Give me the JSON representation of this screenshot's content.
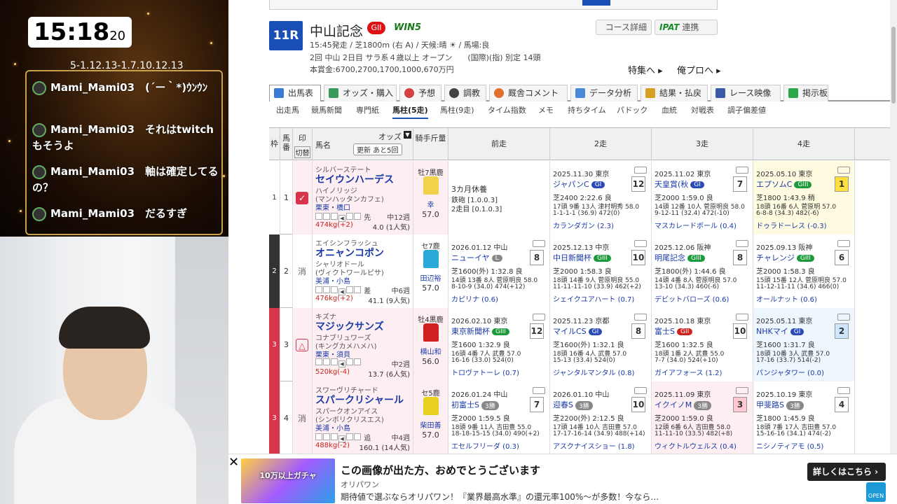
{
  "overlay": {
    "clock_main": "15:18",
    "clock_sec": "20",
    "ticker": "5-1.12.13-1.7.10.12.13",
    "chat": [
      {
        "user": "Mami_Mami03",
        "text": "(´ー｀*)ｳﾝｳﾝ"
      },
      {
        "user": "Mami_Mami03",
        "text": "それはtwitchもそうよ"
      },
      {
        "user": "Mami_Mami03",
        "text": "軸は確定してるの？"
      },
      {
        "user": "Mami_Mami03",
        "text": "だるすぎ"
      }
    ]
  },
  "race": {
    "number": "11R",
    "name": "中山記念",
    "grade": "GII",
    "win5": "WIN5",
    "line1": "15:45発走 / 芝1800m (右 A) / 天候:晴 ☀ / 馬場:良",
    "line2": "2回 中山 2日目 サラ系４歳以上 オープン　　(国際)(指) 別定 14頭",
    "line3": "本賞金:6700,2700,1700,1000,670万円",
    "course_link": "コース詳細",
    "ipat_label": "IPAT",
    "ipat_suffix": "連携",
    "feature_link": "特集へ ▸",
    "pro_link": "俺プロへ ▸"
  },
  "tabs": [
    {
      "label": "出馬表",
      "color": "#3a7bd5"
    },
    {
      "label": "オッズ・購入",
      "color": "#3a9a5a"
    },
    {
      "label": "予想",
      "color": "#d64040"
    },
    {
      "label": "調教",
      "color": "#444444"
    },
    {
      "label": "厩舎コメント",
      "color": "#e07030"
    },
    {
      "label": "データ分析",
      "color": "#4a8ad8"
    },
    {
      "label": "結果・払戻",
      "color": "#d8a020"
    },
    {
      "label": "レース映像",
      "color": "#3a5aa8"
    },
    {
      "label": "掲示板",
      "color": "#2aa84a"
    }
  ],
  "subtabs": [
    "出走馬",
    "競馬新聞",
    "専門紙",
    "馬柱(5走)",
    "馬柱(9走)",
    "タイム指数",
    "メモ",
    "持ちタイム",
    "パドック",
    "血統",
    "対戦表",
    "調子偏差値"
  ],
  "table": {
    "headers": {
      "waku": "枠",
      "uma": "馬番",
      "mark": "印",
      "mark_sub": "切替",
      "horse": "馬名",
      "odds": "オッズ",
      "update": "更新 あと5回",
      "jockey": "騎手斤量",
      "prev": "前走",
      "r2": "2走",
      "r3": "3走",
      "r4": "4走"
    },
    "rows": [
      {
        "waku": "1",
        "uma": "1",
        "mark": "✓",
        "waku_color": "#ffffff",
        "sire": "シルバーステート",
        "name": "セイウンハーデス",
        "dam": "ハイノリッジ",
        "bms": "(マンハッタンカフェ)",
        "stable": "栗東・橋口",
        "weeks": "中12週",
        "weight": "474kg(+2)",
        "odds": "4.0 (1人気)",
        "pos": "先",
        "sexage": "牡7黒鹿",
        "jockey": "幸",
        "kg": "57.0",
        "silk": "#f2d24a",
        "past": [
          {
            "date": "",
            "race": "3カ月休養",
            "l2": "鉄砲 [1.0.0.3]",
            "l3": "2走目 [0.1.0.3]",
            "l4": "",
            "l5": "",
            "place": "",
            "grade": "",
            "gcolor": ""
          },
          {
            "date": "2025.11.30 東京",
            "race": "ジャパンC",
            "grade": "GI",
            "gcolor": "#2a4ab8",
            "place": "12",
            "l2": "芝2400 2:22.6 良",
            "l3": "17頭 9番 13人 津村明秀 58.0",
            "l4": "1-1-1-1 (36.9) 472(0)",
            "l5": "カランダガン (2.3)"
          },
          {
            "date": "2025.11.02 東京",
            "race": "天皇賞(秋",
            "grade": "GI",
            "gcolor": "#2a4ab8",
            "place": "7",
            "l2": "芝2000 1:59.0 良",
            "l3": "14頭 12番 10人 菅原明良 58.0",
            "l4": "9-12-11 (32.4) 472(-10)",
            "l5": "マスカレードボール (0.4)"
          },
          {
            "date": "2025.05.10 東京",
            "race": "エプソムC",
            "grade": "GIII",
            "gcolor": "#1a9a3a",
            "place": "1",
            "l2": "芝1800 1:43.9 稍",
            "l3": "18頭 16番 6人 菅原明 57.0",
            "l4": "6-8-8 (34.3) 482(-6)",
            "l5": "ドゥラドーレス (-0.3)"
          }
        ]
      },
      {
        "waku": "2",
        "uma": "2",
        "mark": "消",
        "waku_color": "#333333",
        "sire": "エイシンフラッシュ",
        "name": "オニャンコポン",
        "dam": "シャリオドール",
        "bms": "(ヴィクトワールピサ)",
        "stable": "美浦・小島",
        "weeks": "中6週",
        "weight": "476kg(+2)",
        "odds": "41.1 (9人気)",
        "pos": "差",
        "sexage": "セ7鹿",
        "jockey": "田辺裕",
        "kg": "57.0",
        "silk": "#2aa8d8",
        "past": [
          {
            "date": "2026.01.12 中山",
            "race": "ニューイヤ",
            "grade": "L",
            "gcolor": "#888888",
            "place": "8",
            "l2": "芝1600(外) 1:32.8 良",
            "l3": "14頭 13番 8人 菅原明良 58.0",
            "l4": "8-10-9 (34.0) 474(+12)",
            "l5": "カピリナ (0.6)"
          },
          {
            "date": "2025.12.13 中京",
            "race": "中日新聞杯",
            "grade": "GIII",
            "gcolor": "#1a9a3a",
            "place": "10",
            "l2": "芝2000 1:58.3 良",
            "l3": "18頭 14番 9人 菅原明良 55.0",
            "l4": "11-11-11-10 (33.9) 462(+2)",
            "l5": "シェイクユアハート (0.7)"
          },
          {
            "date": "2025.12.06 阪神",
            "race": "明尾記念",
            "grade": "GIII",
            "gcolor": "#1a9a3a",
            "place": "8",
            "l2": "芝1800(外) 1:44.6 良",
            "l3": "14頭 4番 8人 菅原明良 57.0",
            "l4": "13-10 (34.3) 460(-6)",
            "l5": "デビットバローズ (0.6)"
          },
          {
            "date": "2025.09.13 阪神",
            "race": "チャレンジ",
            "grade": "GIII",
            "gcolor": "#1a9a3a",
            "place": "6",
            "l2": "芝2000 1:58.3 良",
            "l3": "15頭 15番 12人 菅原明良 57.0",
            "l4": "11-12-11-11 (34.6) 466(0)",
            "l5": "オールナット (0.6)"
          }
        ]
      },
      {
        "waku": "3",
        "uma": "3",
        "mark": "△",
        "waku_color": "#d8344a",
        "sire": "キズナ",
        "name": "マジックサンズ",
        "dam": "コナブリュワーズ",
        "bms": "(キングカメハメハ)",
        "stable": "栗東・須貝",
        "weeks": "中2週",
        "weight": "520kg(-4)",
        "odds": "13.7 (6人気)",
        "pos": "",
        "sexage": "牡4黒鹿",
        "jockey": "横山和",
        "kg": "56.0",
        "silk": "#d02020",
        "past": [
          {
            "date": "2026.02.10 東京",
            "race": "東京新聞杯",
            "grade": "GIII",
            "gcolor": "#1a9a3a",
            "place": "12",
            "l2": "芝1600 1:32.9 良",
            "l3": "16頭 4番 7人 武豊 57.0",
            "l4": "16-16 (33.0) 524(0)",
            "l5": "トロヴァトーレ (0.7)"
          },
          {
            "date": "2025.11.23 京都",
            "race": "マイルCS",
            "grade": "GI",
            "gcolor": "#2a4ab8",
            "place": "8",
            "l2": "芝1600(外) 1:32.1 良",
            "l3": "18頭 16番 4人 武豊 57.0",
            "l4": "15-13 (33.4) 524(0)",
            "l5": "ジャンタルマンタル (0.8)"
          },
          {
            "date": "2025.10.18 東京",
            "race": "富士S",
            "grade": "GII",
            "gcolor": "#d02020",
            "place": "10",
            "l2": "芝1600 1:32.5 良",
            "l3": "18頭 1番 2人 武豊 55.0",
            "l4": "7-7 (34.0) 524(+10)",
            "l5": "ガイアフォース (1.2)"
          },
          {
            "date": "2025.05.11 東京",
            "race": "NHKマイ",
            "grade": "GI",
            "gcolor": "#2a4ab8",
            "place": "2",
            "l2": "芝1600 1:31.7 良",
            "l3": "18頭 10番 3人 武豊 57.0",
            "l4": "17-16 (33.7) 514(-2)",
            "l5": "パンジャタワー (0.0)"
          }
        ]
      },
      {
        "waku": "3",
        "uma": "4",
        "mark": "消",
        "waku_color": "#d8344a",
        "sire": "スワーヴリチャード",
        "name": "スパークリシャール",
        "dam": "スパークオンアイス",
        "bms": "(シンボリクリスエス)",
        "stable": "美浦・小島",
        "weeks": "中4週",
        "weight": "488kg(-2)",
        "odds": "160.1 (14人気)",
        "pos": "追",
        "sexage": "セ5鹿",
        "jockey": "柴田善",
        "kg": "57.0",
        "silk": "#e8d020",
        "past": [
          {
            "date": "2026.01.24 中山",
            "race": "初富士S",
            "grade": "3勝",
            "gcolor": "#888888",
            "place": "7",
            "l2": "芝2000 1:59.5 良",
            "l3": "18頭 9番 11人 吉田豊 55.0",
            "l4": "18-18-15-15 (34.0) 490(+2)",
            "l5": "エセルフリーダ (0.3)"
          },
          {
            "date": "2026.01.10 中山",
            "race": "迎春S",
            "grade": "3勝",
            "gcolor": "#888888",
            "place": "10",
            "l2": "芝2200(外) 2:12.5 良",
            "l3": "17頭 14番 10人 吉田豊 57.0",
            "l4": "17-17-16-14 (34.9) 488(+14)",
            "l5": "アスクナイスショー (1.8)"
          },
          {
            "date": "2025.11.09 東京",
            "race": "イクイノM",
            "grade": "3勝",
            "gcolor": "#888888",
            "place": "3",
            "l2": "芝2000 1:59.0 良",
            "l3": "12頭 6番 6人 吉田豊 58.0",
            "l4": "11-11-10 (33.5) 482(+8)",
            "l5": "ウィクトルウェルス (0.4)"
          },
          {
            "date": "2025.10.19 東京",
            "race": "甲斐路S",
            "grade": "3勝",
            "gcolor": "#888888",
            "place": "4",
            "l2": "芝1800 1:45.9 良",
            "l3": "18頭 7番 17人 吉田豊 57.0",
            "l4": "15-16-16 (34.1) 474(-2)",
            "l5": "ニシノティアモ (0.5)"
          }
        ]
      }
    ]
  },
  "ad": {
    "image_text": "10万以上ガチャ",
    "title": "この画像が出た方、おめでとうございます",
    "source": "オリパワン",
    "desc": "期待値で選ぶならオリパワン！『業界最高水準』の還元率100%〜が多数！今なら…",
    "button": "詳しくはこちら ›",
    "open": "OPEN"
  }
}
